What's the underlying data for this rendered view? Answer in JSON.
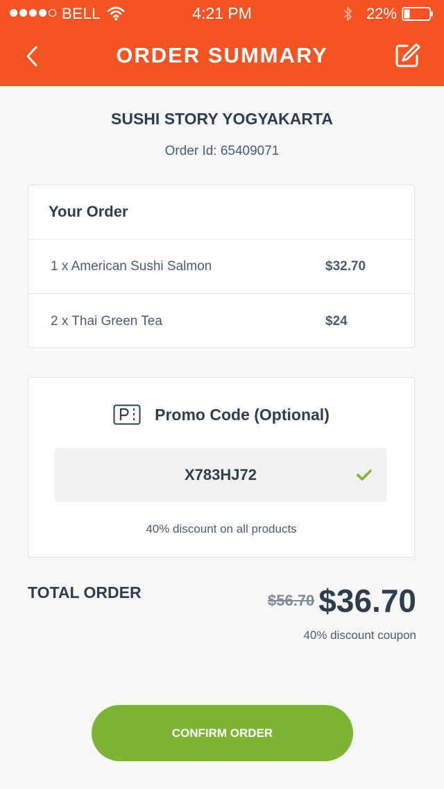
{
  "status_bar": {
    "carrier": "BELL",
    "time": "4:21 PM",
    "battery": "22%",
    "signal_bars_filled": 4,
    "signal_bars_total": 5,
    "icons": [
      "signal-dots-icon",
      "wifi-icon",
      "bluetooth-icon",
      "battery-icon"
    ]
  },
  "header": {
    "title": "ORDER SUMMARY",
    "back_icon": "chevron-left-icon",
    "edit_icon": "edit-icon"
  },
  "restaurant": {
    "name": "SUSHI STORY YOGYAKARTA",
    "order_id": "Order Id: 65409071"
  },
  "order": {
    "title": "Your Order",
    "items": [
      {
        "name": "1 x American Sushi Salmon",
        "price": "$32.70"
      },
      {
        "name": "2 x Thai Green Tea",
        "price": "$24"
      }
    ]
  },
  "promo": {
    "title": "Promo Code (Optional)",
    "icon": "promo-ticket-icon",
    "code": "X783HJ72",
    "valid_icon": "checkmark-icon",
    "note": "40% discount on all products"
  },
  "total": {
    "label": "TOTAL ORDER",
    "old_price": "$56.70",
    "new_price": "$36.70",
    "note": "40% discount coupon"
  },
  "confirm_label": "CONFIRM ORDER",
  "colors": {
    "primary": "#f55322",
    "confirm": "#7db434",
    "text": "#2c3e50",
    "muted": "#4a5d6e",
    "background": "#f7f7f7"
  }
}
